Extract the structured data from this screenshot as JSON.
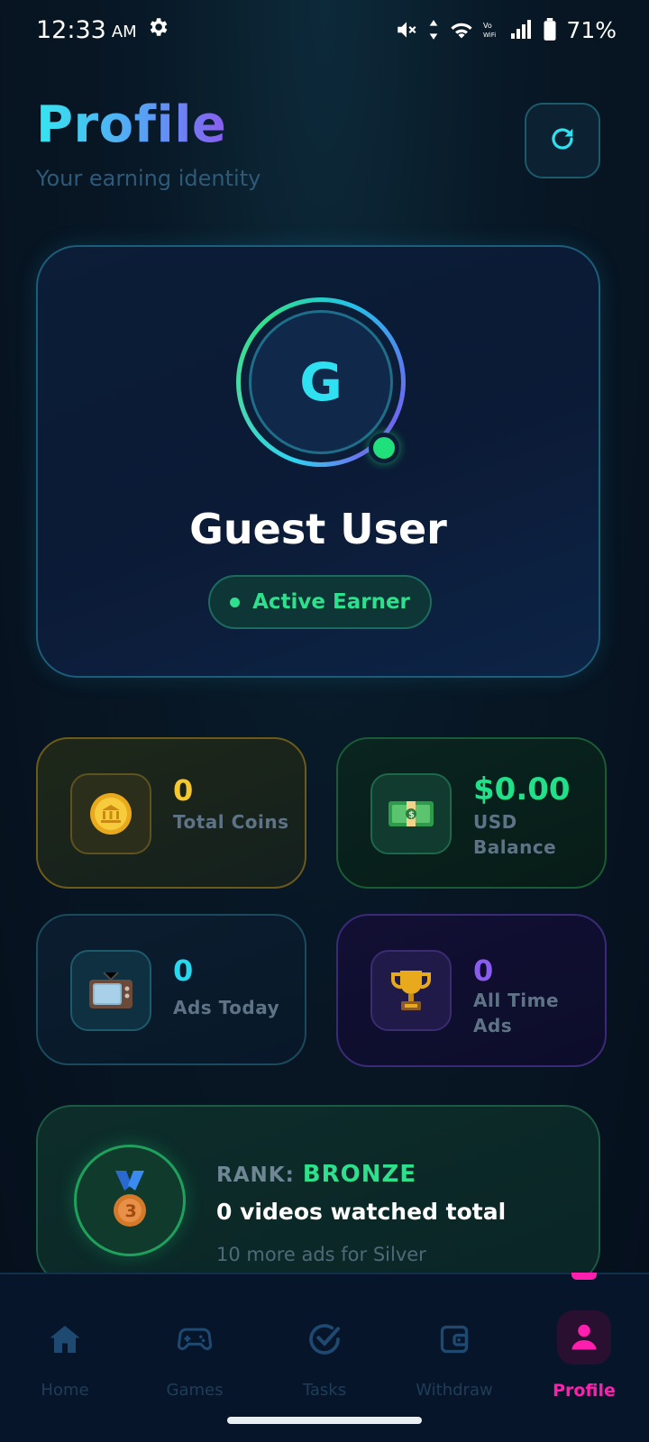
{
  "status_bar": {
    "time": "12:33",
    "ampm": "AM",
    "battery": "71%"
  },
  "header": {
    "title": "Profile",
    "subtitle": "Your earning identity"
  },
  "profile": {
    "avatar_letter": "G",
    "name": "Guest User",
    "status": "Active Earner"
  },
  "stats": {
    "coins": {
      "value": "0",
      "label": "Total Coins",
      "icon": "coin-icon"
    },
    "usd": {
      "value": "$0.00",
      "label": "USD Balance",
      "icon": "money-icon"
    },
    "ads_today": {
      "value": "0",
      "label": "Ads Today",
      "icon": "tv-icon"
    },
    "all_time": {
      "value": "0",
      "label": "All Time Ads",
      "icon": "trophy-icon"
    }
  },
  "rank": {
    "prefix": "RANK:",
    "value": "BRONZE",
    "total": "0 videos watched total",
    "next": "10 more ads for Silver"
  },
  "nav": {
    "items": [
      {
        "label": "Home",
        "icon": "home-icon"
      },
      {
        "label": "Games",
        "icon": "gamepad-icon"
      },
      {
        "label": "Tasks",
        "icon": "check-circle-icon"
      },
      {
        "label": "Withdraw",
        "icon": "wallet-icon"
      },
      {
        "label": "Profile",
        "icon": "user-icon"
      }
    ],
    "active": "Profile"
  },
  "colors": {
    "accent_cyan": "#2ee0f0",
    "accent_green": "#2ee08c",
    "accent_gold": "#f5c830",
    "accent_purple": "#8a5cf0",
    "accent_pink": "#ff1fae"
  }
}
